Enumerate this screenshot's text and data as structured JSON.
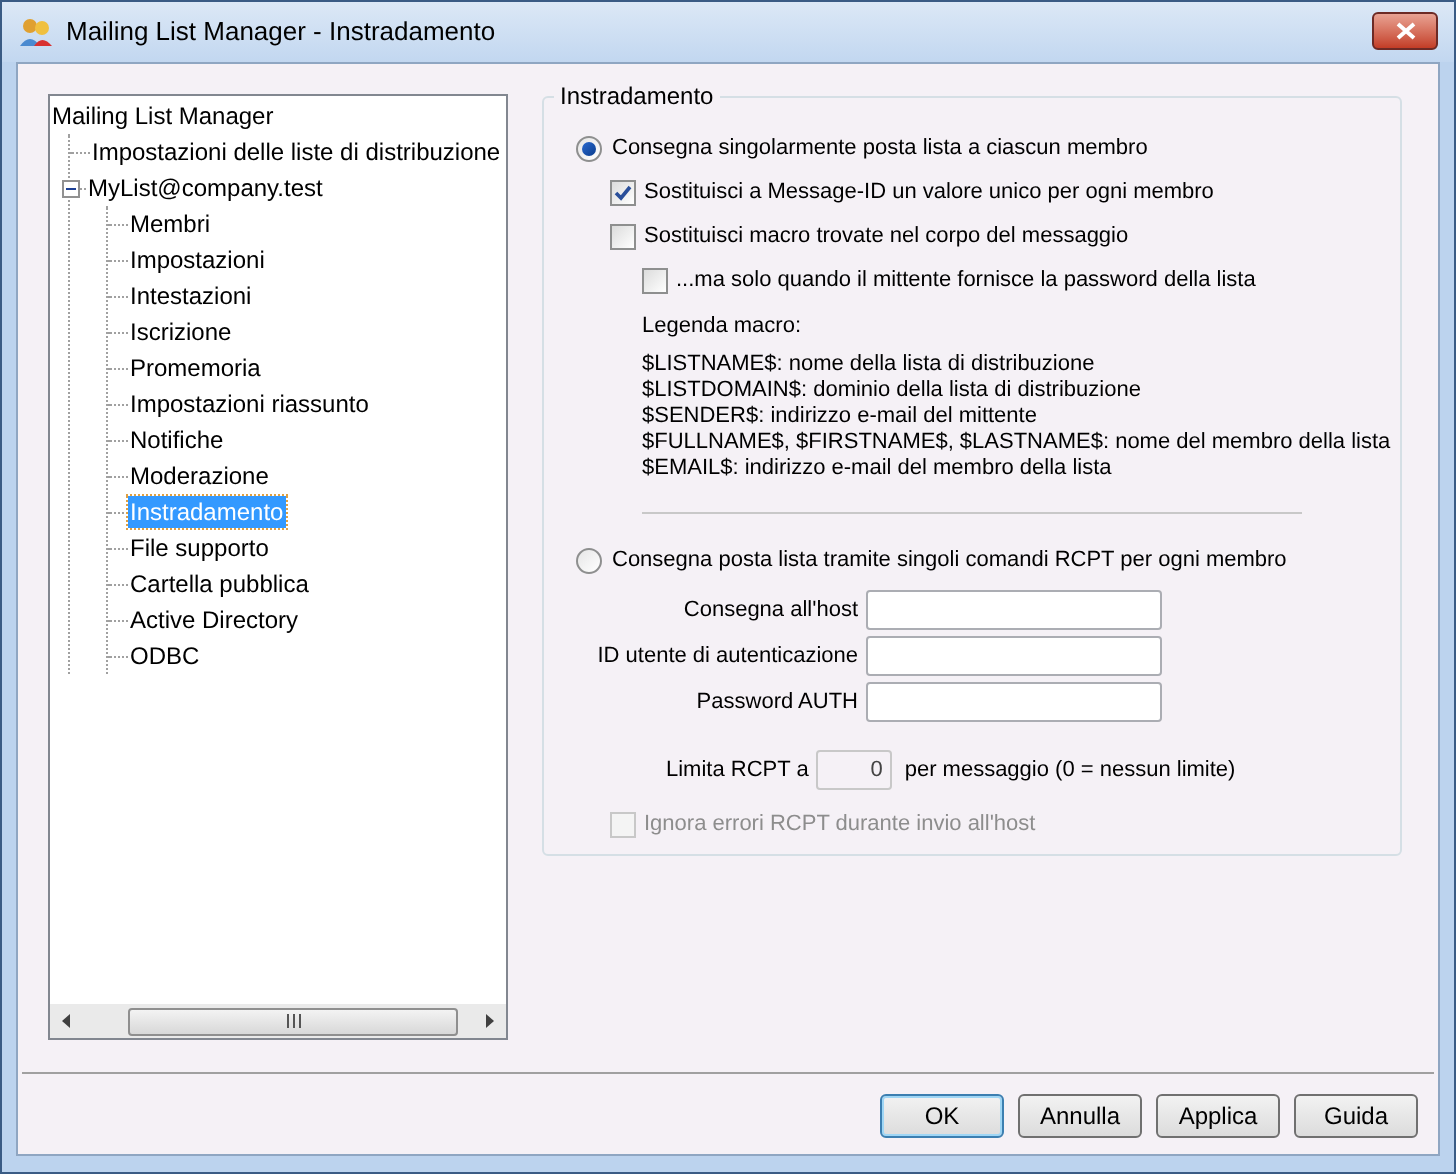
{
  "window": {
    "title": "Mailing List Manager - Instradamento"
  },
  "tree": [
    {
      "label": "Mailing List Manager",
      "selected": false,
      "children": [
        {
          "label": "Impostazioni delle liste di distribuzione",
          "selected": false
        },
        {
          "label": "MyList@company.test",
          "selected": false,
          "expanded": true,
          "children": [
            {
              "label": "Membri",
              "selected": false
            },
            {
              "label": "Impostazioni",
              "selected": false
            },
            {
              "label": "Intestazioni",
              "selected": false
            },
            {
              "label": "Iscrizione",
              "selected": false
            },
            {
              "label": "Promemoria",
              "selected": false
            },
            {
              "label": "Impostazioni riassunto",
              "selected": false
            },
            {
              "label": "Notifiche",
              "selected": false
            },
            {
              "label": "Moderazione",
              "selected": false
            },
            {
              "label": "Instradamento",
              "selected": true
            },
            {
              "label": "File supporto",
              "selected": false
            },
            {
              "label": "Cartella pubblica",
              "selected": false
            },
            {
              "label": "Active Directory",
              "selected": false
            },
            {
              "label": "ODBC",
              "selected": false
            }
          ]
        }
      ]
    }
  ],
  "routing": {
    "title": "Instradamento",
    "individual": {
      "label": "Consegna singolarmente posta lista a ciascun membro",
      "selected": true,
      "options": [
        {
          "label": "Sostituisci a Message-ID un valore unico per ogni membro",
          "checked": true,
          "indent": false
        },
        {
          "label": "Sostituisci macro trovate nel corpo del messaggio",
          "checked": false,
          "indent": false
        },
        {
          "label": "...ma solo quando il mittente fornisce la password della lista",
          "checked": false,
          "indent": true
        }
      ],
      "legend_title": "Legenda macro:",
      "legend": [
        "$LISTNAME$: nome della lista di distribuzione",
        "$LISTDOMAIN$: dominio della lista di distribuzione",
        "$SENDER$: indirizzo e-mail del mittente",
        "$FULLNAME$, $FIRSTNAME$, $LASTNAME$: nome del membro della lista",
        "$EMAIL$: indirizzo e-mail del membro della lista"
      ]
    },
    "rcpt": {
      "label": "Consegna posta lista tramite singoli comandi RCPT per ogni membro",
      "selected": false,
      "fields": [
        {
          "label": "Consegna all'host"
        },
        {
          "label": "ID utente di autenticazione"
        },
        {
          "label": "Password AUTH"
        }
      ],
      "limit": {
        "label": "Limita RCPT a",
        "value": "0",
        "suffix": "per messaggio (0 = nessun limite)",
        "disabled": true
      },
      "ignore": {
        "label": "Ignora errori RCPT durante invio all'host",
        "checked": false,
        "disabled": true
      }
    }
  },
  "buttons": [
    {
      "label": "OK",
      "default": true
    },
    {
      "label": "Annulla",
      "default": false
    },
    {
      "label": "Applica",
      "default": false
    },
    {
      "label": "Guida",
      "default": false
    }
  ]
}
